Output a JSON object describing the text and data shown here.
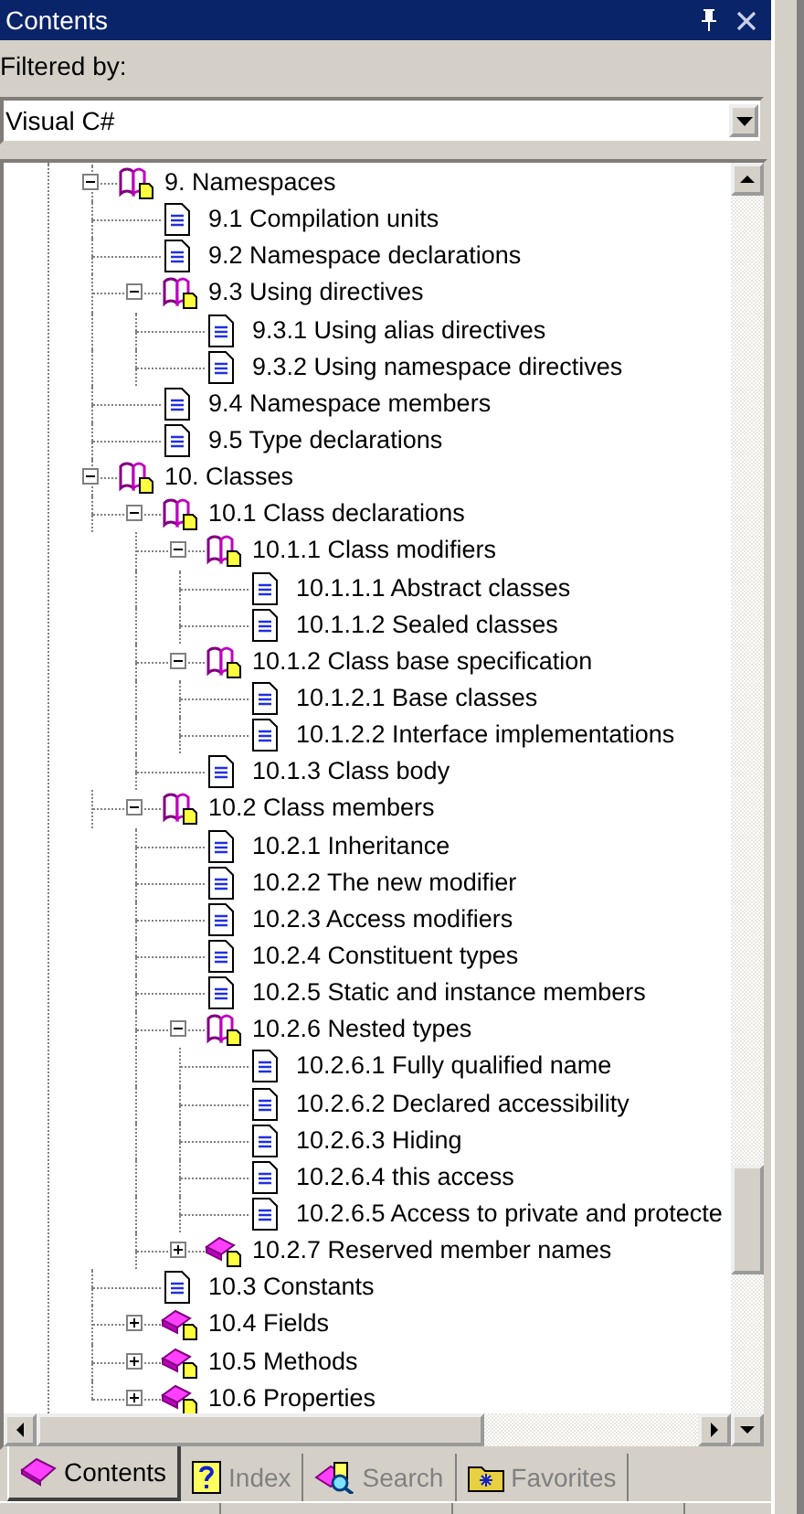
{
  "window": {
    "title": "Contents"
  },
  "filter": {
    "label": "Filtered by:",
    "value": "Visual C#"
  },
  "tree": [
    {
      "label": "9. Namespaces",
      "kind": "book",
      "expanded": true,
      "children": [
        {
          "label": "9.1 Compilation units",
          "kind": "page"
        },
        {
          "label": "9.2 Namespace declarations",
          "kind": "page"
        },
        {
          "label": "9.3 Using directives",
          "kind": "book",
          "expanded": true,
          "children": [
            {
              "label": "9.3.1 Using alias directives",
              "kind": "page"
            },
            {
              "label": "9.3.2 Using namespace directives",
              "kind": "page"
            }
          ]
        },
        {
          "label": "9.4 Namespace members",
          "kind": "page"
        },
        {
          "label": "9.5 Type declarations",
          "kind": "page"
        }
      ]
    },
    {
      "label": "10. Classes",
      "kind": "book",
      "expanded": true,
      "children": [
        {
          "label": "10.1 Class declarations",
          "kind": "book",
          "expanded": true,
          "children": [
            {
              "label": "10.1.1 Class modifiers",
              "kind": "book",
              "expanded": true,
              "children": [
                {
                  "label": "10.1.1.1 Abstract classes",
                  "kind": "page"
                },
                {
                  "label": "10.1.1.2 Sealed classes",
                  "kind": "page"
                }
              ]
            },
            {
              "label": "10.1.2 Class base specification",
              "kind": "book",
              "expanded": true,
              "children": [
                {
                  "label": "10.1.2.1 Base classes",
                  "kind": "page"
                },
                {
                  "label": "10.1.2.2 Interface implementations",
                  "kind": "page"
                }
              ]
            },
            {
              "label": "10.1.3 Class body",
              "kind": "page"
            }
          ]
        },
        {
          "label": "10.2 Class members",
          "kind": "book",
          "expanded": true,
          "children": [
            {
              "label": "10.2.1 Inheritance",
              "kind": "page"
            },
            {
              "label": "10.2.2 The new modifier",
              "kind": "page"
            },
            {
              "label": "10.2.3 Access modifiers",
              "kind": "page"
            },
            {
              "label": "10.2.4 Constituent types",
              "kind": "page"
            },
            {
              "label": "10.2.5 Static and instance members",
              "kind": "page"
            },
            {
              "label": "10.2.6 Nested types",
              "kind": "book",
              "expanded": true,
              "children": [
                {
                  "label": "10.2.6.1 Fully qualified name",
                  "kind": "page"
                },
                {
                  "label": "10.2.6.2 Declared accessibility",
                  "kind": "page"
                },
                {
                  "label": "10.2.6.3 Hiding",
                  "kind": "page"
                },
                {
                  "label": "10.2.6.4 this access",
                  "kind": "page"
                },
                {
                  "label": "10.2.6.5 Access to private and protecte",
                  "kind": "page"
                }
              ]
            },
            {
              "label": "10.2.7 Reserved member names",
              "kind": "book",
              "expanded": false
            }
          ]
        },
        {
          "label": "10.3 Constants",
          "kind": "page"
        },
        {
          "label": "10.4 Fields",
          "kind": "book",
          "expanded": false
        },
        {
          "label": "10.5 Methods",
          "kind": "book",
          "expanded": false
        },
        {
          "label": "10.6 Properties",
          "kind": "book",
          "expanded": false
        }
      ]
    }
  ],
  "tabs": [
    {
      "label": "Contents",
      "kind": "contents",
      "selected": true
    },
    {
      "label": "Index",
      "kind": "index",
      "selected": false
    },
    {
      "label": "Search",
      "kind": "search",
      "selected": false
    },
    {
      "label": "Favorites",
      "kind": "favorites",
      "selected": false
    }
  ]
}
